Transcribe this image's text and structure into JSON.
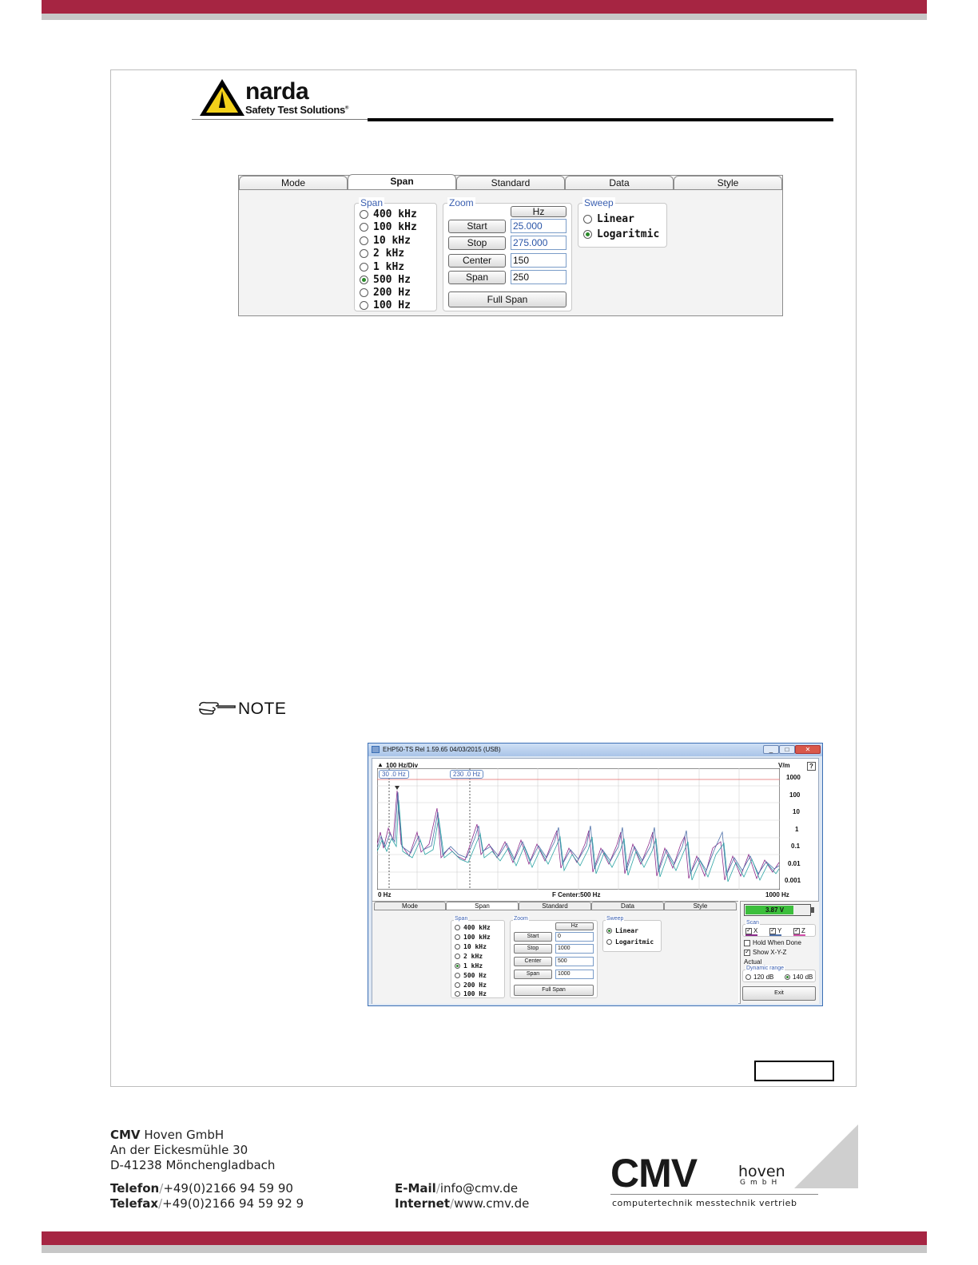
{
  "header": {
    "brand_name": "narda",
    "brand_sub": "Safety Test Solutions",
    "brand_mark": "®"
  },
  "panel": {
    "tabs": [
      {
        "label": "Mode",
        "active": false
      },
      {
        "label": "Span",
        "active": true
      },
      {
        "label": "Standard",
        "active": false
      },
      {
        "label": "Data",
        "active": false
      },
      {
        "label": "Style",
        "active": false
      }
    ],
    "span": {
      "title": "Span",
      "options": [
        "400 kHz",
        "100 kHz",
        "10  kHz",
        "2 kHz",
        "1 kHz",
        "500 Hz",
        "200 Hz",
        "100 Hz"
      ],
      "selected": "500 Hz"
    },
    "zoom": {
      "title": "Zoom",
      "unit": "Hz",
      "start_label": "Start",
      "start_value": "25.000",
      "stop_label": "Stop",
      "stop_value": "275.000",
      "center_label": "Center",
      "center_value": "150",
      "span_label": "Span",
      "span_value": "250",
      "full_span_label": "Full Span"
    },
    "sweep": {
      "title": "Sweep",
      "linear": "Linear",
      "logaritmic": "Logaritmic",
      "selected": "Logaritmic"
    }
  },
  "note": {
    "label": "NOTE"
  },
  "window": {
    "title": "EHP50-TS Rel 1.59.65 04/03/2015 (USB)",
    "minimize": "_",
    "maximize": "□",
    "close": "✕",
    "div_label": "100 Hz/Div",
    "unit": "V/m",
    "help": "?",
    "marker1": "30 .0  Hz",
    "marker2": "230 .0  Hz",
    "y_ticks": [
      "1000",
      "100",
      "10",
      "1",
      "0.1",
      "0.01",
      "0.001"
    ],
    "x_start": "0 Hz",
    "x_center": "F Center:500 Hz",
    "x_end": "1000 Hz",
    "tabs": [
      "Mode",
      "Span",
      "Standard",
      "Data",
      "Style"
    ],
    "span": {
      "title": "Span",
      "options": [
        "400 kHz",
        "100 kHz",
        "10  kHz",
        "2 kHz",
        "1 kHz",
        "500 Hz",
        "200 Hz",
        "100 Hz"
      ],
      "selected": "1 kHz"
    },
    "zoom": {
      "title": "Zoom",
      "unit": "Hz",
      "start_label": "Start",
      "start_value": "0",
      "stop_label": "Stop",
      "stop_value": "1000",
      "center_label": "Center",
      "center_value": "500",
      "span_label": "Span",
      "span_value": "1000",
      "full_span_label": "Full Span"
    },
    "sweep": {
      "title": "Sweep",
      "linear": "Linear",
      "logaritmic": "Logaritmic",
      "selected": "Linear"
    },
    "battery": {
      "label": "3.87 V",
      "level": 0.75
    },
    "scan": {
      "title": "Scan",
      "x": "X",
      "y": "Y",
      "z": "Z"
    },
    "hold_when_done": "Hold When Done",
    "show_xyz": "Show X-Y-Z",
    "actual": "Actual",
    "dynamic_range": {
      "title": "Dynamic range",
      "opt1": "120 dB",
      "opt2": "140 dB",
      "selected": "140 dB"
    },
    "exit_label": "Exit"
  },
  "footer": {
    "company_bold": "CMV",
    "company_rest": " Hoven GmbH",
    "street": "An der Eickesmühle 30",
    "city": "D-41238 Mönchengladbach",
    "tel_label": "Telefon",
    "tel_value": "+49(0)2166 94 59 90",
    "fax_label": "Telefax",
    "fax_value": "+49(0)2166 94 59 92 9",
    "mail_label": "E-Mail",
    "mail_value": "info@cmv.de",
    "web_label": "Internet",
    "web_value": "www.cmv.de",
    "logo_big": "CMV",
    "logo_hoven": "hoven",
    "logo_gmbh": "GmbH",
    "logo_tagline": "computertechnik messtechnik vertrieb"
  },
  "colors": {
    "brand_red": "#a62542",
    "trace_x": "#8b2c8b",
    "trace_y": "#4b6ea8",
    "trace_z": "#2aa3a3"
  }
}
